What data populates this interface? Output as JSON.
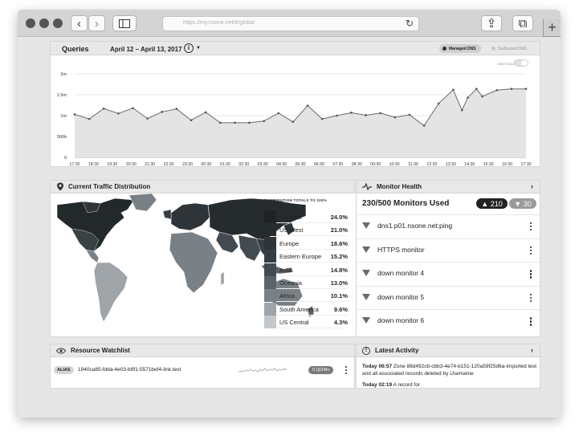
{
  "browser": {
    "url": "https://my.nsone.net/#/global",
    "back_glyph": "‹",
    "forward_glyph": "›",
    "reload_glyph": "↻",
    "share_glyph": "⇪",
    "tabs_glyph": "⧉",
    "new_tab_glyph": "+"
  },
  "queries": {
    "title": "Queries",
    "date_range": "April 12 – April 13, 2017",
    "info_glyph": "i",
    "caret_glyph": "▼",
    "toggle_managed": "Managed DNS",
    "toggle_dedicated": "Dedicated DNS",
    "view_stacked": "VIEW STACKED"
  },
  "chart_data": {
    "type": "area",
    "x": [
      "17:30",
      "18:30",
      "19:30",
      "20:30",
      "21:30",
      "22:30",
      "23:30",
      "00:30",
      "01:30",
      "02:30",
      "03:30",
      "04:30",
      "05:30",
      "06:30",
      "07:30",
      "08:30",
      "09:30",
      "10:30",
      "11:30",
      "12:30",
      "13:30",
      "14:30",
      "15:30",
      "16:30",
      "17:30"
    ],
    "y_ticks": [
      "0",
      "500k",
      "1m",
      "1.5m",
      "2m"
    ],
    "ylim": [
      0,
      2000000
    ],
    "series": [
      {
        "values": [
          [
            0,
            1030000
          ],
          [
            1,
            920000
          ],
          [
            2,
            1170000
          ],
          [
            3,
            1050000
          ],
          [
            4,
            1180000
          ],
          [
            5,
            930000
          ],
          [
            6,
            1090000
          ],
          [
            7,
            1160000
          ],
          [
            8,
            890000
          ],
          [
            9,
            1080000
          ],
          [
            10,
            830000
          ],
          [
            11,
            830000
          ],
          [
            12,
            830000
          ],
          [
            13,
            870000
          ],
          [
            14,
            1060000
          ],
          [
            15,
            850000
          ],
          [
            16,
            1240000
          ],
          [
            17,
            920000
          ],
          [
            18,
            1000000
          ],
          [
            19,
            1070000
          ],
          [
            20,
            1010000
          ],
          [
            21,
            1060000
          ],
          [
            22,
            960000
          ],
          [
            23,
            1020000
          ],
          [
            24,
            760000
          ],
          [
            25,
            1290000
          ],
          [
            26,
            1620000
          ],
          [
            26.6,
            1130000
          ],
          [
            27,
            1430000
          ],
          [
            27.6,
            1640000
          ],
          [
            28,
            1460000
          ],
          [
            29,
            1610000
          ],
          [
            30,
            1640000
          ],
          [
            31,
            1640000
          ]
        ]
      }
    ],
    "grid": true
  },
  "traffic": {
    "title": "Current Traffic Distribution",
    "legend_title": "DISTRIBUTION TOTALS TO 100%",
    "regions": [
      {
        "name": "US East",
        "pct": "24.0%",
        "color": "#1f2326"
      },
      {
        "name": "US West",
        "pct": "21.0%",
        "color": "#262b2e"
      },
      {
        "name": "Europe",
        "pct": "18.6%",
        "color": "#2e3438"
      },
      {
        "name": "Eastern Europe",
        "pct": "15.2%",
        "color": "#373e43"
      },
      {
        "name": "Asia",
        "pct": "14.8%",
        "color": "#434a50"
      },
      {
        "name": "Oceania",
        "pct": "13.0%",
        "color": "#5d6469"
      },
      {
        "name": "Africa",
        "pct": "10.1%",
        "color": "#7a8186"
      },
      {
        "name": "South America",
        "pct": "9.6%",
        "color": "#9ea4a8"
      },
      {
        "name": "US Central",
        "pct": "4.3%",
        "color": "#c4c8cb"
      }
    ]
  },
  "monitor": {
    "title": "Monitor Health",
    "count": "230/500 Monitors Used",
    "up": "▲ 210",
    "down": "▼ 30",
    "items": [
      {
        "name": "dns1.p01.nsone.net:ping"
      },
      {
        "name": "HTTPS monitor"
      },
      {
        "name": "down monitor 4"
      },
      {
        "name": "down monitor 5"
      },
      {
        "name": "down monitor 6"
      }
    ]
  },
  "watchlist": {
    "title": "Resource Watchlist",
    "row": {
      "type": "ALIAS",
      "name": "1940ca85-fdda-4e03-b9f1-5571bef4-link.test",
      "rate": "0 Q/24hr"
    }
  },
  "activity": {
    "title": "Latest Activity",
    "items": [
      {
        "time": "Today 06:57",
        "text": "Zone 88d492cb-cbb3-4e74-b151-120a59f25d6a-imported test and all associated records deleted by",
        "user": "Usemame"
      },
      {
        "time": "Today 02:19",
        "text": "A record for",
        "user": ""
      }
    ]
  }
}
